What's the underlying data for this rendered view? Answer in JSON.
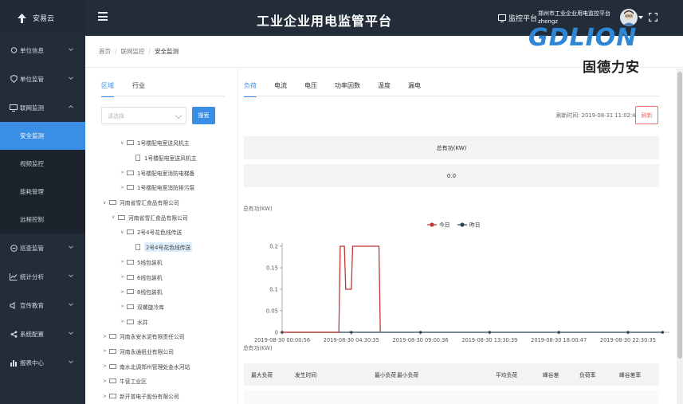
{
  "app": {
    "name": "安易云",
    "title": "工业企业用电监管平台",
    "platform_label": "监控平台",
    "user_name": "郑州市工业企业用电监控平台 zhengz"
  },
  "brand": {
    "latin": "GDLION",
    "chinese": "固德力安",
    "color": "#2e86d4"
  },
  "sidebar": {
    "items": [
      {
        "label": "单位信息",
        "icon": "location-icon"
      },
      {
        "label": "单位监管",
        "icon": "shield-icon"
      },
      {
        "label": "联网监测",
        "icon": "monitor-icon"
      },
      {
        "label": "巡查监管",
        "icon": "patrol-icon"
      },
      {
        "label": "统计分析",
        "icon": "chart-icon"
      },
      {
        "label": "宣传教育",
        "icon": "speaker-icon"
      },
      {
        "label": "系统配置",
        "icon": "share-icon"
      },
      {
        "label": "报表中心",
        "icon": "bar-chart-icon"
      }
    ],
    "subitems": [
      {
        "label": "安全监测",
        "active": true
      },
      {
        "label": "视频监控",
        "active": false
      },
      {
        "label": "能耗管理",
        "active": false
      },
      {
        "label": "远程控制",
        "active": false
      }
    ]
  },
  "breadcrumb": [
    "首页",
    "联网监控",
    "安全监测"
  ],
  "tree_panel": {
    "tabs": [
      "区域",
      "行业"
    ],
    "select_placeholder": "请选择",
    "search_label": "搜索",
    "nodes": [
      {
        "label": "1号楼配电室送风机主",
        "level": 1,
        "type": "folder",
        "expanded": true
      },
      {
        "label": "1号楼配电室送风机主",
        "level": 2,
        "type": "file"
      },
      {
        "label": "1号楼配电室消防电梯备",
        "level": 1,
        "type": "folder",
        "expanded": false
      },
      {
        "label": "1号楼配电室消防排污泵",
        "level": 1,
        "type": "folder",
        "expanded": false
      },
      {
        "label": "河南省雪汇食品有限公司",
        "level": -1,
        "type": "folder",
        "expanded": true
      },
      {
        "label": "河南省雪汇食品有限公司",
        "level": 0,
        "type": "folder",
        "expanded": true
      },
      {
        "label": "2号4号花色线传送",
        "level": 1,
        "type": "folder",
        "expanded": true
      },
      {
        "label": "2号4号花色线传送",
        "level": 2,
        "type": "file",
        "selected": true
      },
      {
        "label": "5线包装机",
        "level": 1,
        "type": "folder",
        "expanded": false
      },
      {
        "label": "6线包装机",
        "level": 1,
        "type": "folder",
        "expanded": false
      },
      {
        "label": "8线包装机",
        "level": 1,
        "type": "folder",
        "expanded": false
      },
      {
        "label": "双螺旋冷库",
        "level": 1,
        "type": "folder",
        "expanded": false
      },
      {
        "label": "水井",
        "level": 1,
        "type": "folder",
        "expanded": false
      },
      {
        "label": "河南永安水泥有限责任公司",
        "level": -1,
        "type": "folder",
        "expanded": false
      },
      {
        "label": "河南永通纸业有限公司",
        "level": -1,
        "type": "folder",
        "expanded": false
      },
      {
        "label": "南水北调郑州管理处金水河站",
        "level": -1,
        "type": "folder",
        "expanded": false
      },
      {
        "label": "牛营工业区",
        "level": -1,
        "type": "folder",
        "expanded": false
      },
      {
        "label": "新开普电子股份有限公司",
        "level": -1,
        "type": "folder",
        "expanded": false
      }
    ]
  },
  "content": {
    "tabs": [
      "负荷",
      "电流",
      "电压",
      "功率因数",
      "温度",
      "漏电"
    ],
    "refresh_time": "刷新时间: 2019-08-31 11:02:44",
    "refresh_label": "刷新",
    "stat_header": "总有功(KW)",
    "stat_value": "0.0",
    "table_headers": [
      "最大负荷",
      "发生时间",
      "最小负荷",
      "最小负荷",
      "平均负荷",
      "峰谷差",
      "负荷率",
      "峰谷差率"
    ]
  },
  "chart_data": {
    "type": "line",
    "ylabel": "总有功(KW)",
    "ylabel_bottom": "总有功(KW)",
    "ylim": [
      0,
      0.2
    ],
    "yticks": [
      "0",
      "0.05",
      "0.1",
      "0.15",
      "0.2"
    ],
    "xticks": [
      "2019-08-30 00:00:56",
      "2019-08-30 04:30:35",
      "2019-08-30 09:00:36",
      "2019-08-30 13:30:39",
      "2019-08-30 18:00:47",
      "2019-08-30 22:30:35"
    ],
    "series": [
      {
        "name": "今日",
        "color": "#c23531",
        "points": [
          [
            0,
            0
          ],
          [
            0.82,
            0
          ],
          [
            0.84,
            0.2
          ],
          [
            0.9,
            0.2
          ],
          [
            0.92,
            0.1
          ],
          [
            1.0,
            0.1
          ],
          [
            1.02,
            0.2
          ],
          [
            1.4,
            0.2
          ],
          [
            1.42,
            0
          ]
        ]
      },
      {
        "name": "昨日",
        "color": "#2f4554",
        "points": [
          [
            0,
            0
          ],
          [
            1.0,
            0
          ],
          [
            2.0,
            0
          ],
          [
            3.0,
            0
          ],
          [
            4.0,
            0
          ],
          [
            5.0,
            0
          ],
          [
            5.5,
            0
          ]
        ]
      }
    ],
    "grid": false,
    "legend": "top-center"
  }
}
